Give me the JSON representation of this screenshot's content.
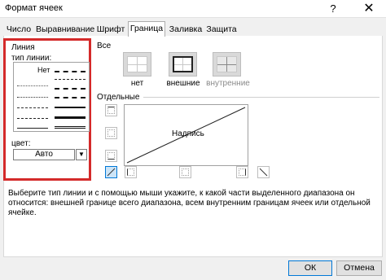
{
  "window": {
    "title": "Формат ячеек",
    "help_label": "?",
    "close_label": "✕"
  },
  "tabs": [
    {
      "label": "Число"
    },
    {
      "label": "Выравнивание"
    },
    {
      "label": "Шрифт"
    },
    {
      "label": "Граница"
    },
    {
      "label": "Заливка"
    },
    {
      "label": "Защита"
    }
  ],
  "active_tab": "Граница",
  "line": {
    "group_label": "Линия",
    "type_label": "тип линии:",
    "none_label": "Нет",
    "color_label": "цвет:",
    "color_value": "Авто"
  },
  "presets": {
    "group_label": "Все",
    "items": [
      {
        "label": "нет"
      },
      {
        "label": "внешние"
      },
      {
        "label": "внутренние"
      }
    ]
  },
  "border": {
    "group_label": "Отдельные",
    "preview_text": "Надпись"
  },
  "description": "Выберите тип линии и с помощью мыши укажите, к какой части выделенного диапазона он относится: внешней границе всего диапазона, всем внутренним границам ячеек или отдельной ячейке.",
  "buttons": {
    "ok": "ОК",
    "cancel": "Отмена"
  },
  "colors": {
    "highlight": "#d42a2a",
    "accent": "#0078d7"
  }
}
